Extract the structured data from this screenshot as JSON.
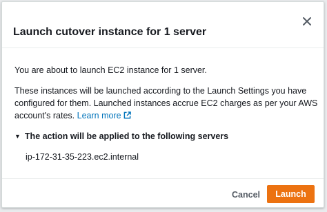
{
  "modal": {
    "title": "Launch cutover instance for 1 server",
    "intro": "You are about to launch EC2 instance for 1 server.",
    "description": "These instances will be launched according to the Launch Settings you have configured for them. Launched instances accrue EC2 charges as per your AWS account's rates.",
    "learn_more": "Learn more",
    "expander_label": "The action will be applied to the following servers",
    "servers": [
      "ip-172-31-35-223.ec2.internal"
    ]
  },
  "footer": {
    "cancel_label": "Cancel",
    "launch_label": "Launch"
  },
  "colors": {
    "primary_button": "#ec7211",
    "link": "#0073bb"
  },
  "icons": {
    "close": "close-icon",
    "external_link": "external-link-icon",
    "caret": "caret-down-icon"
  }
}
